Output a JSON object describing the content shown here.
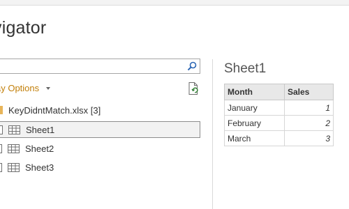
{
  "window": {
    "title": "vigator"
  },
  "navigator": {
    "search_placeholder": "",
    "display_options_label": "ay Options",
    "file": {
      "label": "KeyDidntMatch.xlsx [3]"
    },
    "sheets": [
      {
        "label": "Sheet1",
        "selected": true,
        "checked": false
      },
      {
        "label": "Sheet2",
        "selected": false,
        "checked": false
      },
      {
        "label": "Sheet3",
        "selected": false,
        "checked": false
      }
    ]
  },
  "preview": {
    "title": "Sheet1",
    "columns": [
      "Month",
      "Sales"
    ],
    "rows": [
      [
        "January",
        "1"
      ],
      [
        "February",
        "2"
      ],
      [
        "March",
        "3"
      ]
    ]
  },
  "colors": {
    "accent": "#c27f09",
    "folder": "#e8b55a",
    "selected_row_bg": "#f2f2f2"
  },
  "icons": {
    "search": "search-icon",
    "refresh": "refresh-document-icon",
    "folder": "folder-icon",
    "sheet": "sheet-grid-icon",
    "caret": "chevron-down-icon"
  }
}
